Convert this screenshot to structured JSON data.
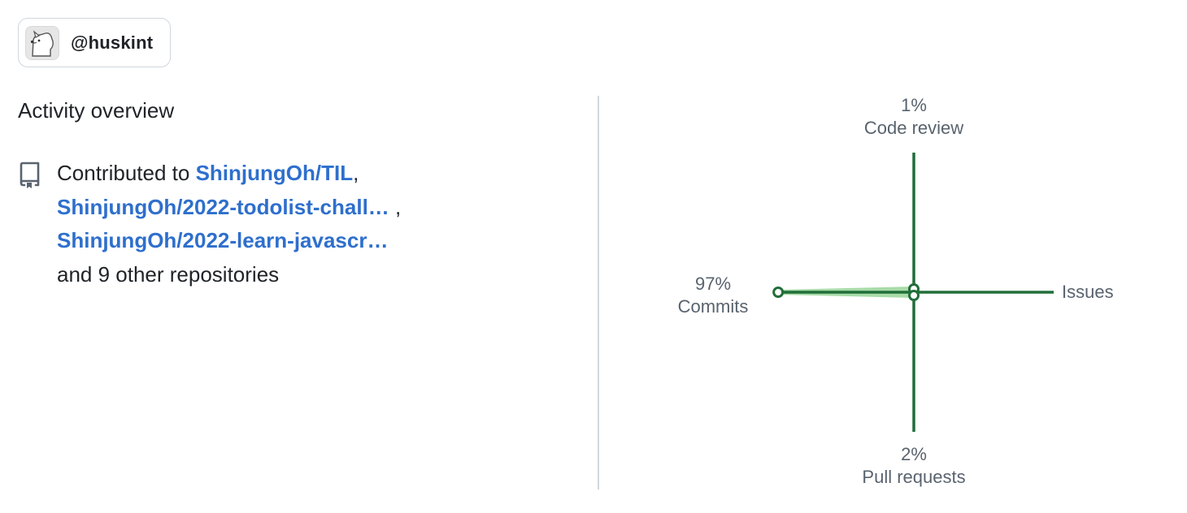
{
  "user": {
    "handle": "@huskint"
  },
  "activity": {
    "title": "Activity overview",
    "contributed_prefix": "Contributed to ",
    "repos": [
      "ShinjungOh/TIL",
      "ShinjungOh/2022-todolist-chall…",
      "ShinjungOh/2022-learn-javascr…"
    ],
    "separator": ",",
    "others": "and 9 other repositories"
  },
  "chart_data": {
    "type": "radar",
    "axes": [
      {
        "name": "Code review",
        "percent": 1,
        "label": "1%"
      },
      {
        "name": "Issues",
        "percent": 0,
        "label": ""
      },
      {
        "name": "Pull requests",
        "percent": 2,
        "label": "2%"
      },
      {
        "name": "Commits",
        "percent": 97,
        "label": "97%"
      }
    ],
    "colors": {
      "axis": "#216e39",
      "fill": "#a8dba8",
      "marker_stroke": "#216e39",
      "marker_fill": "#ffffff"
    }
  }
}
